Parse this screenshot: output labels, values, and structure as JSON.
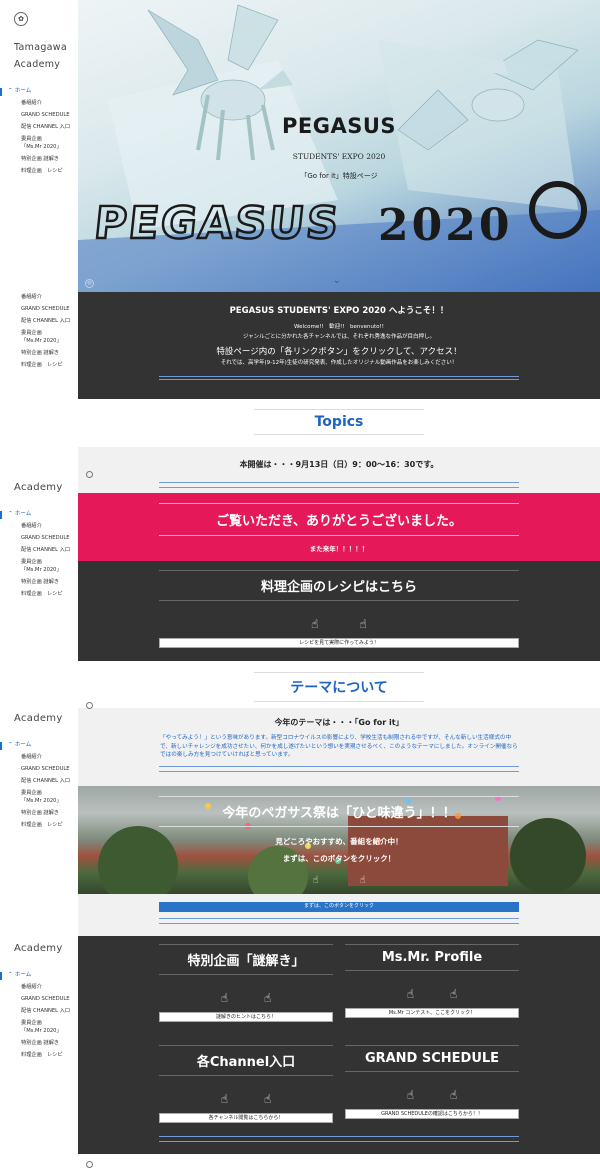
{
  "sidebar": {
    "brand_line1": "Tamagawa",
    "brand_line2": "Academy",
    "brand_short": "Academy",
    "home": "ホーム",
    "items": [
      "番組紹介",
      "GRAND SCHEDULE",
      "配信 CHANNEL 入口",
      "委員企画「Ms.Mr 2020」",
      "特別企画 謎解き",
      "料理企画　レシピ"
    ],
    "items_compact": [
      "番組紹介",
      "GRAND SCHEDULE",
      "配信 CHANNEL 入口",
      "委員企画",
      "「Ms.Mr 2020」",
      "特別企画 謎解き",
      "料理企画　レシピ"
    ]
  },
  "hero": {
    "title": "PEGASUS",
    "subtitle": "STUDENTS' EXPO 2020",
    "tagline": "「Go for it」特設ページ",
    "art_left": "PEGASUS",
    "art_right": "2020"
  },
  "welcome": {
    "heading": "PEGASUS STUDENTS' EXPO 2020 へようこそ！！",
    "greet": "Welcome!!　歓迎!!　benvenuto!!",
    "line1": "ジャンルごとに分かれた各チャンネルでは、それぞれ秀逸な作品が目白押し。",
    "line2": "特設ページ内の「各リンクボタン」をクリックして、アクセス！",
    "line3": "それでは、高学年(9-12年)生徒の研究発表、作成したオリジナル動画作品をお楽しみください！"
  },
  "topics": {
    "title": "Topics",
    "schedule": "本開催は・・・9月13日（日）9：00～16：30です。",
    "thanks": "ご覧いただき、ありがとうございました。",
    "next_year": "また来年！！！！！",
    "recipe_title": "料理企画のレシピはこちら",
    "recipe_button": "レシピを見て実際に作ってみよう！"
  },
  "theme": {
    "title": "テーマについて",
    "theme_line": "今年のテーマは・・・「Go for it」",
    "desc": "「やってみよう！」という意味があります。新型コロナウイルスの影響により、学校生活も制限される中ですが、そんな新しい生活様式の中で、新しいチャレンジを成功させたい、何かを成し遂げたいという想いを実現させるべく、このようなテーマにしました。オンライン開催ならではの楽しみ方を見つけていければと思っています。",
    "photo_title": "今年のペガサス祭は「ひと味違う」！！",
    "photo_sub1": "見どころやおすすめ、番組を紹介中！",
    "photo_sub2": "まずは、このボタンをクリック！",
    "photo_button": "まずは、このボタンをクリック"
  },
  "links": {
    "nazotoki_title": "特別企画「謎解き」",
    "nazotoki_button": "謎解きのヒントはこちら！",
    "profile_title": "Ms.Mr. Profile",
    "profile_button": "Ms.Mr コンテスト、ここをクリック！",
    "channel_title": "各Channel入口",
    "channel_button": "各チャンネル閲覧はこちらから！",
    "schedule_title": "GRAND SCHEDULE",
    "schedule_button": "GRAND SCHEDULEの確認はこちらから！！"
  },
  "colors": {
    "accent_blue": "#1e63c4",
    "pink": "#e5195a",
    "dark": "#333333"
  }
}
